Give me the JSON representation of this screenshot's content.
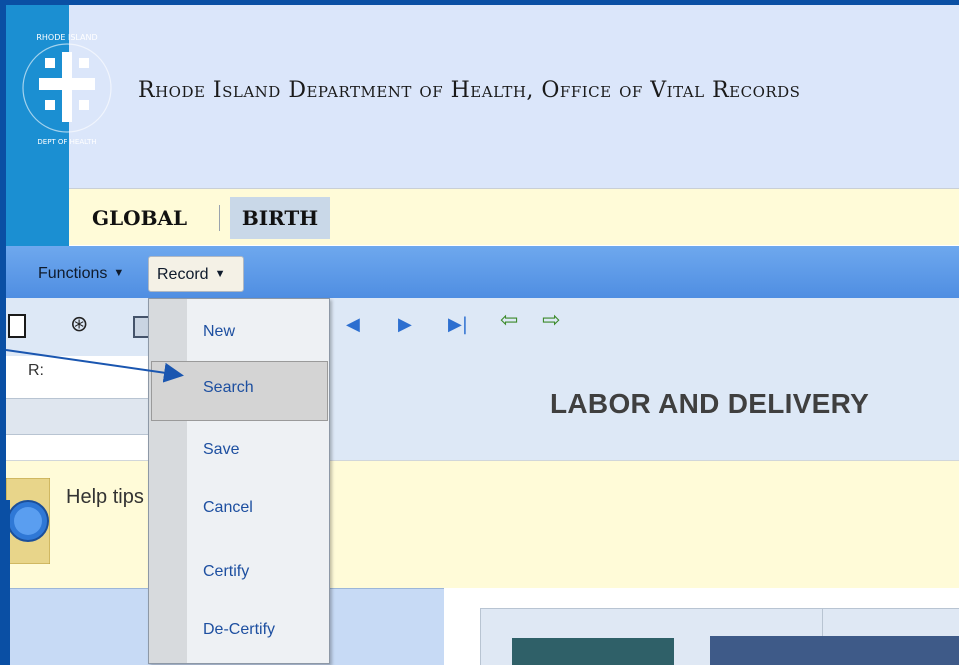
{
  "header": {
    "title": "Rhode Island Department of Health, Office of Vital Records",
    "logo_name": "ri-doh-seal-logo",
    "logo_text": "RHODE ISLAND DEPARTMENT OF HEALTH"
  },
  "tabs": [
    {
      "label": "GLOBAL",
      "active": false
    },
    {
      "label": "BIRTH",
      "active": true
    }
  ],
  "menubar": {
    "functions_label": "Functions",
    "record_label": "Record"
  },
  "record_menu": {
    "items": [
      "New",
      "Search",
      "Save",
      "Cancel",
      "Certify",
      "De-Certify"
    ],
    "highlighted": "Search"
  },
  "toolbar": {
    "icons": [
      "new-document-icon",
      "binoculars-find-icon",
      "save-disk-icon",
      "first-record-icon",
      "next-record-icon",
      "last-record-icon",
      "back-arrow-icon",
      "forward-arrow-icon"
    ]
  },
  "left_panel": {
    "field_label": "R:"
  },
  "section": {
    "title": "LABOR AND DELIVERY"
  },
  "help": {
    "label": "Help tips"
  },
  "colors": {
    "frame_blue": "#0a4fa4",
    "header_bg": "#dbe6fa",
    "tab_bar_bg": "#fffbd8",
    "menu_bar_blue": "#5b98e6",
    "menu_item_text": "#1d4fa0",
    "logo_strip": "#1b8fd2"
  }
}
